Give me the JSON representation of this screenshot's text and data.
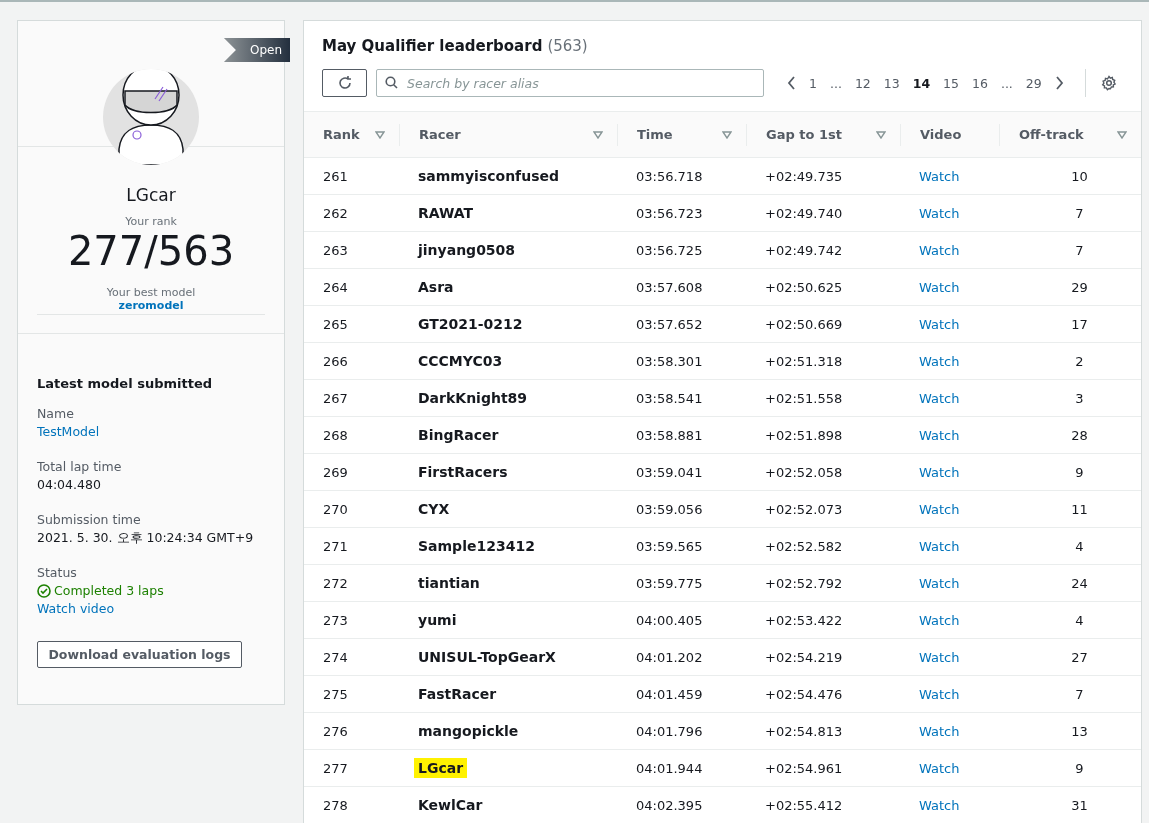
{
  "profile": {
    "badge": "Open",
    "name": "LGcar",
    "rank_label": "Your rank",
    "rank": "277/563",
    "best_model_label": "Your best model",
    "best_model": "zeromodel"
  },
  "latest_model": {
    "title": "Latest model submitted",
    "fields": [
      {
        "label": "Name",
        "value": "TestModel",
        "kind": "link"
      },
      {
        "label": "Total lap time",
        "value": "04:04.480",
        "kind": "text"
      },
      {
        "label": "Submission time",
        "value": "2021. 5. 30. 오후 10:24:34 GMT+9",
        "kind": "text"
      },
      {
        "label": "Status",
        "value": "Completed 3 laps",
        "kind": "status",
        "link": "Watch video"
      }
    ],
    "button": "Download evaluation logs"
  },
  "leaderboard": {
    "title": "May Qualifier leaderboard",
    "count": "(563)",
    "search": {
      "placeholder": "Search by racer alias"
    },
    "pages": [
      {
        "label": "1",
        "selected": false
      },
      {
        "label": "...",
        "selected": false
      },
      {
        "label": "12",
        "selected": false
      },
      {
        "label": "13",
        "selected": false
      },
      {
        "label": "14",
        "selected": true
      },
      {
        "label": "15",
        "selected": false
      },
      {
        "label": "16",
        "selected": false
      },
      {
        "label": "...",
        "selected": false
      },
      {
        "label": "29",
        "selected": false
      }
    ],
    "columns": [
      {
        "label": "Rank",
        "sortable": true
      },
      {
        "label": "Racer",
        "sortable": true
      },
      {
        "label": "Time",
        "sortable": true
      },
      {
        "label": "Gap to 1st",
        "sortable": true
      },
      {
        "label": "Video",
        "sortable": false
      },
      {
        "label": "Off-track",
        "sortable": true
      }
    ],
    "rows": [
      {
        "rank": "261",
        "racer": "sammyisconfused",
        "time": "03:56.718",
        "gap": "+02:49.735",
        "video": "Watch",
        "off_track": "10",
        "highlighted": false
      },
      {
        "rank": "262",
        "racer": "RAWAT",
        "time": "03:56.723",
        "gap": "+02:49.740",
        "video": "Watch",
        "off_track": "7",
        "highlighted": false
      },
      {
        "rank": "263",
        "racer": "jinyang0508",
        "time": "03:56.725",
        "gap": "+02:49.742",
        "video": "Watch",
        "off_track": "7",
        "highlighted": false
      },
      {
        "rank": "264",
        "racer": "Asra",
        "time": "03:57.608",
        "gap": "+02:50.625",
        "video": "Watch",
        "off_track": "29",
        "highlighted": false
      },
      {
        "rank": "265",
        "racer": "GT2021-0212",
        "time": "03:57.652",
        "gap": "+02:50.669",
        "video": "Watch",
        "off_track": "17",
        "highlighted": false
      },
      {
        "rank": "266",
        "racer": "CCCMYC03",
        "time": "03:58.301",
        "gap": "+02:51.318",
        "video": "Watch",
        "off_track": "2",
        "highlighted": false
      },
      {
        "rank": "267",
        "racer": "DarkKnight89",
        "time": "03:58.541",
        "gap": "+02:51.558",
        "video": "Watch",
        "off_track": "3",
        "highlighted": false
      },
      {
        "rank": "268",
        "racer": "BingRacer",
        "time": "03:58.881",
        "gap": "+02:51.898",
        "video": "Watch",
        "off_track": "28",
        "highlighted": false
      },
      {
        "rank": "269",
        "racer": "FirstRacers",
        "time": "03:59.041",
        "gap": "+02:52.058",
        "video": "Watch",
        "off_track": "9",
        "highlighted": false
      },
      {
        "rank": "270",
        "racer": "CYX",
        "time": "03:59.056",
        "gap": "+02:52.073",
        "video": "Watch",
        "off_track": "11",
        "highlighted": false
      },
      {
        "rank": "271",
        "racer": "Sample123412",
        "time": "03:59.565",
        "gap": "+02:52.582",
        "video": "Watch",
        "off_track": "4",
        "highlighted": false
      },
      {
        "rank": "272",
        "racer": "tiantian",
        "time": "03:59.775",
        "gap": "+02:52.792",
        "video": "Watch",
        "off_track": "24",
        "highlighted": false
      },
      {
        "rank": "273",
        "racer": "yumi",
        "time": "04:00.405",
        "gap": "+02:53.422",
        "video": "Watch",
        "off_track": "4",
        "highlighted": false
      },
      {
        "rank": "274",
        "racer": "UNISUL-TopGearX",
        "time": "04:01.202",
        "gap": "+02:54.219",
        "video": "Watch",
        "off_track": "27",
        "highlighted": false
      },
      {
        "rank": "275",
        "racer": "FastRacer",
        "time": "04:01.459",
        "gap": "+02:54.476",
        "video": "Watch",
        "off_track": "7",
        "highlighted": false
      },
      {
        "rank": "276",
        "racer": "mangopickle",
        "time": "04:01.796",
        "gap": "+02:54.813",
        "video": "Watch",
        "off_track": "13",
        "highlighted": false
      },
      {
        "rank": "277",
        "racer": "LGcar",
        "time": "04:01.944",
        "gap": "+02:54.961",
        "video": "Watch",
        "off_track": "9",
        "highlighted": true
      },
      {
        "rank": "278",
        "racer": "KewlCar",
        "time": "04:02.395",
        "gap": "+02:55.412",
        "video": "Watch",
        "off_track": "31",
        "highlighted": false
      }
    ]
  }
}
